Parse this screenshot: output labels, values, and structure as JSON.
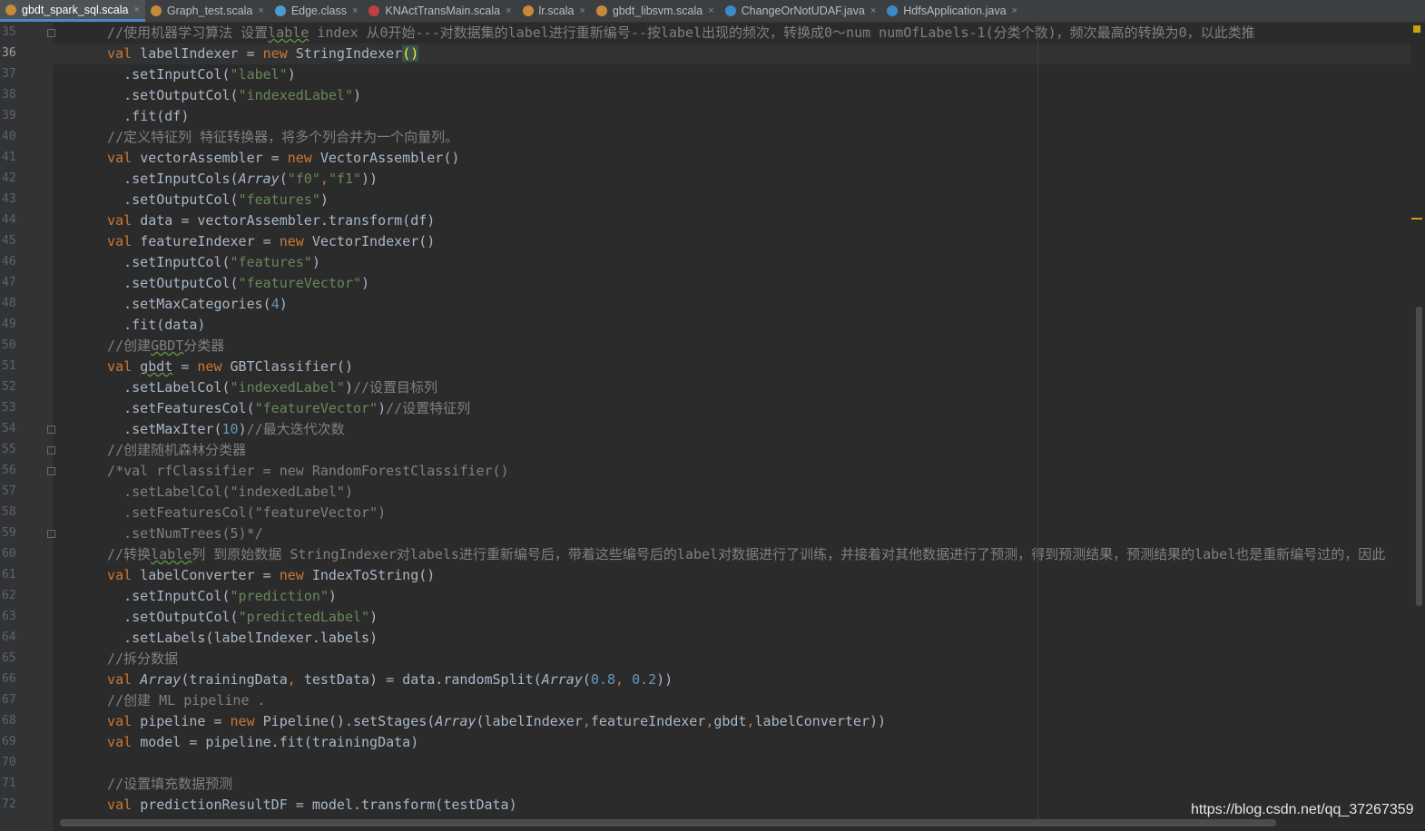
{
  "tabs": [
    {
      "label": "gbdt_spark_sql.scala",
      "icon": "scala-object-icon",
      "active": true
    },
    {
      "label": "Graph_test.scala",
      "icon": "scala-object-icon",
      "active": false
    },
    {
      "label": "Edge.class",
      "icon": "class-file-icon",
      "active": false
    },
    {
      "label": "KNActTransMain.scala",
      "icon": "scala-file-icon",
      "active": false
    },
    {
      "label": "lr.scala",
      "icon": "scala-object-icon",
      "active": false
    },
    {
      "label": "gbdt_libsvm.scala",
      "icon": "scala-object-icon",
      "active": false
    },
    {
      "label": "ChangeOrNotUDAF.java",
      "icon": "java-class-icon",
      "active": false
    },
    {
      "label": "HdfsApplication.java",
      "icon": "java-class-icon",
      "active": false
    }
  ],
  "close_glyph": "×",
  "colors": {
    "keyword": "#cc7832",
    "string": "#6a8759",
    "number": "#6897bb",
    "comment": "#808080",
    "text": "#a9b7c6",
    "background": "#2b2b2b"
  },
  "current_line": 36,
  "code_lines": [
    {
      "n": "35",
      "t": [
        [
          "cmt",
          "  //使用机器学习算法 设置"
        ],
        [
          "cmt squig",
          "lable"
        ],
        [
          "cmt",
          " index 从0开始---对数据集的label进行重新编号--按label出现的频次，转换成0～num numOfLabels-1(分类个数)，频次最高的转换为0，以此类推"
        ]
      ]
    },
    {
      "n": "36",
      "t": [
        [
          "kw",
          "  val "
        ],
        [
          "",
          "labelIndexer = "
        ],
        [
          "kw",
          "new "
        ],
        [
          "",
          "StringIndexer"
        ],
        [
          "brace",
          "()"
        ]
      ]
    },
    {
      "n": "37",
      "t": [
        [
          "",
          "    .setInputCol("
        ],
        [
          "str",
          "\"label\""
        ],
        [
          "",
          ")"
        ]
      ]
    },
    {
      "n": "38",
      "t": [
        [
          "",
          "    .setOutputCol("
        ],
        [
          "str",
          "\"indexedLabel\""
        ],
        [
          "",
          ")"
        ]
      ]
    },
    {
      "n": "39",
      "t": [
        [
          "",
          "    .fit(df)"
        ]
      ]
    },
    {
      "n": "40",
      "t": [
        [
          "cmt",
          "  //定义特征列 特征转换器，将多个列合并为一个向量列。"
        ]
      ]
    },
    {
      "n": "41",
      "t": [
        [
          "kw",
          "  val "
        ],
        [
          "",
          "vectorAssembler = "
        ],
        [
          "kw",
          "new "
        ],
        [
          "",
          "VectorAssembler()"
        ]
      ]
    },
    {
      "n": "42",
      "t": [
        [
          "",
          "    .setInputCols("
        ],
        [
          "it",
          "Array"
        ],
        [
          "",
          "("
        ],
        [
          "str",
          "\"f0\""
        ],
        [
          "kw",
          ","
        ],
        [
          "str",
          "\"f1\""
        ],
        [
          "",
          "))"
        ]
      ]
    },
    {
      "n": "43",
      "t": [
        [
          "",
          "    .setOutputCol("
        ],
        [
          "str",
          "\"features\""
        ],
        [
          "",
          ")"
        ]
      ]
    },
    {
      "n": "44",
      "t": [
        [
          "kw",
          "  val "
        ],
        [
          "",
          "data = vectorAssembler.transform(df)"
        ]
      ]
    },
    {
      "n": "45",
      "t": [
        [
          "kw",
          "  val "
        ],
        [
          "",
          "featureIndexer = "
        ],
        [
          "kw",
          "new "
        ],
        [
          "",
          "VectorIndexer()"
        ]
      ]
    },
    {
      "n": "46",
      "t": [
        [
          "",
          "    .setInputCol("
        ],
        [
          "str",
          "\"features\""
        ],
        [
          "",
          ")"
        ]
      ]
    },
    {
      "n": "47",
      "t": [
        [
          "",
          "    .setOutputCol("
        ],
        [
          "str",
          "\"featureVector\""
        ],
        [
          "",
          ")"
        ]
      ]
    },
    {
      "n": "48",
      "t": [
        [
          "",
          "    .setMaxCategories("
        ],
        [
          "num",
          "4"
        ],
        [
          "",
          ")"
        ]
      ]
    },
    {
      "n": "49",
      "t": [
        [
          "",
          "    .fit(data)"
        ]
      ]
    },
    {
      "n": "50",
      "t": [
        [
          "cmt",
          "  //创建"
        ],
        [
          "cmt squig",
          "GBDT"
        ],
        [
          "cmt",
          "分类器"
        ]
      ]
    },
    {
      "n": "51",
      "t": [
        [
          "kw",
          "  val "
        ],
        [
          "squig",
          "gbdt"
        ],
        [
          "",
          " = "
        ],
        [
          "kw",
          "new "
        ],
        [
          "",
          "GBTClassifier()"
        ]
      ]
    },
    {
      "n": "52",
      "t": [
        [
          "",
          "    .setLabelCol("
        ],
        [
          "str",
          "\"indexedLabel\""
        ],
        [
          "",
          ")"
        ],
        [
          "cmt",
          "//设置目标列"
        ]
      ]
    },
    {
      "n": "53",
      "t": [
        [
          "",
          "    .setFeaturesCol("
        ],
        [
          "str",
          "\"featureVector\""
        ],
        [
          "",
          ")"
        ],
        [
          "cmt",
          "//设置特征列"
        ]
      ]
    },
    {
      "n": "54",
      "t": [
        [
          "",
          "    .setMaxIter("
        ],
        [
          "num",
          "10"
        ],
        [
          "",
          ")"
        ],
        [
          "cmt",
          "//最大迭代次数"
        ]
      ]
    },
    {
      "n": "55",
      "t": [
        [
          "cmt",
          "  //创建随机森林分类器"
        ]
      ]
    },
    {
      "n": "56",
      "t": [
        [
          "cmt",
          "  /*val rfClassifier = new RandomForestClassifier()"
        ]
      ]
    },
    {
      "n": "57",
      "t": [
        [
          "cmt",
          "    .setLabelCol(\"indexedLabel\")"
        ]
      ]
    },
    {
      "n": "58",
      "t": [
        [
          "cmt",
          "    .setFeaturesCol(\"featureVector\")"
        ]
      ]
    },
    {
      "n": "59",
      "t": [
        [
          "cmt",
          "    .setNumTrees(5)*/"
        ]
      ]
    },
    {
      "n": "60",
      "t": [
        [
          "cmt",
          "  //转换"
        ],
        [
          "cmt squig",
          "lable"
        ],
        [
          "cmt",
          "列 到原始数据 StringIndexer对labels进行重新编号后，带着这些编号后的label对数据进行了训练，并接着对其他数据进行了预测，得到预测结果，预测结果的label也是重新编号过的，因此"
        ]
      ]
    },
    {
      "n": "61",
      "t": [
        [
          "kw",
          "  val "
        ],
        [
          "",
          "labelConverter = "
        ],
        [
          "kw",
          "new "
        ],
        [
          "",
          "IndexToString()"
        ]
      ]
    },
    {
      "n": "62",
      "t": [
        [
          "",
          "    .setInputCol("
        ],
        [
          "str",
          "\"prediction\""
        ],
        [
          "",
          ")"
        ]
      ]
    },
    {
      "n": "63",
      "t": [
        [
          "",
          "    .setOutputCol("
        ],
        [
          "str",
          "\"predictedLabel\""
        ],
        [
          "",
          ")"
        ]
      ]
    },
    {
      "n": "64",
      "t": [
        [
          "",
          "    .setLabels(labelIndexer.labels)"
        ]
      ]
    },
    {
      "n": "65",
      "t": [
        [
          "cmt",
          "  //拆分数据"
        ]
      ]
    },
    {
      "n": "66",
      "t": [
        [
          "kw",
          "  val "
        ],
        [
          "it",
          "Array"
        ],
        [
          "",
          "(trainingData"
        ],
        [
          "kw",
          ", "
        ],
        [
          "",
          "testData) = data.randomSplit("
        ],
        [
          "it",
          "Array"
        ],
        [
          "",
          "("
        ],
        [
          "num",
          "0.8"
        ],
        [
          "kw",
          ", "
        ],
        [
          "num",
          "0.2"
        ],
        [
          "",
          "))"
        ]
      ]
    },
    {
      "n": "67",
      "t": [
        [
          "cmt",
          "  //创建 ML pipeline ."
        ]
      ]
    },
    {
      "n": "68",
      "t": [
        [
          "kw",
          "  val "
        ],
        [
          "",
          "pipeline = "
        ],
        [
          "kw",
          "new "
        ],
        [
          "",
          "Pipeline().setStages("
        ],
        [
          "it",
          "Array"
        ],
        [
          "",
          "(labelIndexer"
        ],
        [
          "kw",
          ","
        ],
        [
          "",
          "featureIndexer"
        ],
        [
          "kw",
          ","
        ],
        [
          "",
          "gbdt"
        ],
        [
          "kw",
          ","
        ],
        [
          "",
          "labelConverter))"
        ]
      ]
    },
    {
      "n": "69",
      "t": [
        [
          "kw",
          "  val "
        ],
        [
          "",
          "model = pipeline.fit(trainingData)"
        ]
      ]
    },
    {
      "n": "70",
      "t": []
    },
    {
      "n": "71",
      "t": [
        [
          "cmt",
          "  //设置填充数据预测"
        ]
      ]
    },
    {
      "n": "72",
      "t": [
        [
          "kw",
          "  val "
        ],
        [
          "",
          "predictionResultDF = model.transform(testData)"
        ]
      ]
    }
  ],
  "fold_lines": [
    35,
    54,
    55,
    56,
    59
  ],
  "watermark": "https://blog.csdn.net/qq_37267359"
}
